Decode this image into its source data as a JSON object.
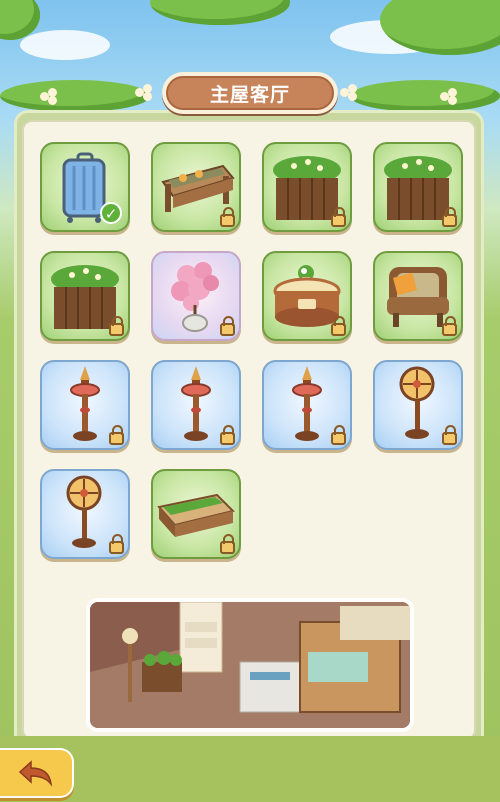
{
  "header": {
    "title": "主屋客厅"
  },
  "items": [
    {
      "name": "suitcase",
      "bg": "green",
      "state": "owned"
    },
    {
      "name": "wooden-bench",
      "bg": "green",
      "state": "locked"
    },
    {
      "name": "flower-planter",
      "bg": "green",
      "state": "locked"
    },
    {
      "name": "flower-planter",
      "bg": "green",
      "state": "locked"
    },
    {
      "name": "flower-planter",
      "bg": "green",
      "state": "locked"
    },
    {
      "name": "cherry-blossom-pot",
      "bg": "pink",
      "state": "locked"
    },
    {
      "name": "round-flower-table",
      "bg": "green",
      "state": "locked"
    },
    {
      "name": "armchair",
      "bg": "green",
      "state": "locked"
    },
    {
      "name": "standing-lamp",
      "bg": "blue",
      "state": "locked"
    },
    {
      "name": "standing-lamp",
      "bg": "blue",
      "state": "locked"
    },
    {
      "name": "standing-lamp",
      "bg": "blue",
      "state": "locked"
    },
    {
      "name": "electric-fan",
      "bg": "blue",
      "state": "locked"
    },
    {
      "name": "electric-fan",
      "bg": "blue",
      "state": "locked"
    },
    {
      "name": "long-planter-bench",
      "bg": "green",
      "state": "locked"
    }
  ],
  "colors": {
    "panel": "#f7f4e6",
    "title": "#c7845a",
    "back_button": "#f6c94d"
  },
  "footer": {
    "back_icon": "back-arrow-icon"
  }
}
